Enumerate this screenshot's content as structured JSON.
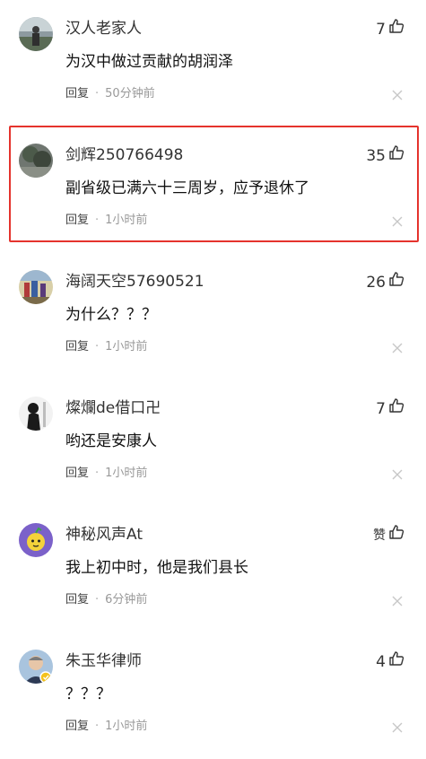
{
  "comments": [
    {
      "username": "汉人老家人",
      "text": "为汉中做过贡献的胡润泽",
      "reply": "回复",
      "dot": "·",
      "time": "50分钟前",
      "likes": "7"
    },
    {
      "username": "剑辉250766498",
      "text": "副省级已满六十三周岁，应予退休了",
      "reply": "回复",
      "dot": "·",
      "time": "1小时前",
      "likes": "35"
    },
    {
      "username": "海阔天空57690521",
      "text": "为什么？？？",
      "reply": "回复",
      "dot": "·",
      "time": "1小时前",
      "likes": "26"
    },
    {
      "username": "燦爛de借口卍",
      "text": "哟还是安康人",
      "reply": "回复",
      "dot": "·",
      "time": "1小时前",
      "likes": "7"
    },
    {
      "username": "神秘风声At",
      "text": "我上初中时，他是我们县长",
      "reply": "回复",
      "dot": "·",
      "time": "6分钟前",
      "likes": "赞"
    },
    {
      "username": "朱玉华律师",
      "text": "？？？",
      "reply": "回复",
      "dot": "·",
      "time": "1小时前",
      "likes": "4"
    }
  ],
  "icons": {
    "like": "thumbs-up-icon",
    "close": "close-icon"
  },
  "colors": {
    "highlight": "#e5332d",
    "meta": "#999999",
    "badge": "#f4c21b"
  }
}
